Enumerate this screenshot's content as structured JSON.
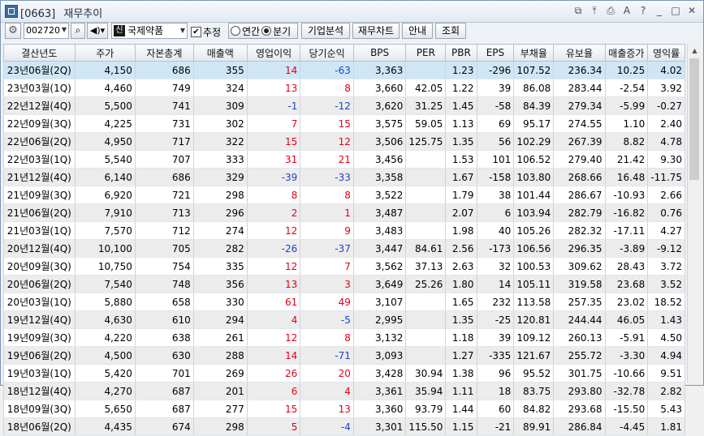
{
  "window": {
    "code": "[0663]",
    "title": "재무추이",
    "buttons": [
      "restore-icon",
      "pin-icon",
      "screenshot-icon",
      "text-size-icon",
      "help-icon",
      "minimize-icon",
      "maximize-icon",
      "close-icon"
    ]
  },
  "toolbar": {
    "stock_code": "002720",
    "stock_badge": "신",
    "stock_name": "국제약품",
    "estimate_label": "추정",
    "estimate_checked": true,
    "radio_annual": "연간",
    "radio_quarter": "분기",
    "selected_period": "분기",
    "btn_analysis": "기업분석",
    "btn_chart": "재무차트",
    "btn_guide": "안내",
    "btn_query": "조회"
  },
  "table": {
    "columns": [
      "결산년도",
      "주가",
      "자본총계",
      "매출액",
      "영업이익",
      "당기순익",
      "BPS",
      "PER",
      "PBR",
      "EPS",
      "부채율",
      "유보율",
      "매출증가",
      "영익률"
    ],
    "rows": [
      [
        "23년06월(2Q)",
        "4,150",
        "686",
        "355",
        "14",
        "-63",
        "3,363",
        "",
        "1.23",
        "-296",
        "107.52",
        "236.34",
        "10.25",
        "4.02"
      ],
      [
        "23년03월(1Q)",
        "4,460",
        "749",
        "324",
        "13",
        "8",
        "3,660",
        "42.05",
        "1.22",
        "39",
        "86.08",
        "283.44",
        "-2.54",
        "3.92"
      ],
      [
        "22년12월(4Q)",
        "5,500",
        "741",
        "309",
        "-1",
        "-12",
        "3,620",
        "31.25",
        "1.45",
        "-58",
        "84.39",
        "279.34",
        "-5.99",
        "-0.27"
      ],
      [
        "22년09월(3Q)",
        "4,225",
        "731",
        "302",
        "7",
        "15",
        "3,575",
        "59.05",
        "1.13",
        "69",
        "95.17",
        "274.55",
        "1.10",
        "2.40"
      ],
      [
        "22년06월(2Q)",
        "4,950",
        "717",
        "322",
        "15",
        "12",
        "3,506",
        "125.75",
        "1.35",
        "56",
        "102.29",
        "267.39",
        "8.82",
        "4.78"
      ],
      [
        "22년03월(1Q)",
        "5,540",
        "707",
        "333",
        "31",
        "21",
        "3,456",
        "",
        "1.53",
        "101",
        "106.52",
        "279.40",
        "21.42",
        "9.30"
      ],
      [
        "21년12월(4Q)",
        "6,140",
        "686",
        "329",
        "-39",
        "-33",
        "3,358",
        "",
        "1.67",
        "-158",
        "103.80",
        "268.66",
        "16.48",
        "-11.75"
      ],
      [
        "21년09월(3Q)",
        "6,920",
        "721",
        "298",
        "8",
        "8",
        "3,522",
        "",
        "1.79",
        "38",
        "101.44",
        "286.67",
        "-10.93",
        "2.66"
      ],
      [
        "21년06월(2Q)",
        "7,910",
        "713",
        "296",
        "2",
        "1",
        "3,487",
        "",
        "2.07",
        "6",
        "103.94",
        "282.79",
        "-16.82",
        "0.76"
      ],
      [
        "21년03월(1Q)",
        "7,570",
        "712",
        "274",
        "12",
        "9",
        "3,483",
        "",
        "1.98",
        "40",
        "105.26",
        "282.32",
        "-17.11",
        "4.27"
      ],
      [
        "20년12월(4Q)",
        "10,100",
        "705",
        "282",
        "-26",
        "-37",
        "3,447",
        "84.61",
        "2.56",
        "-173",
        "106.56",
        "296.35",
        "-3.89",
        "-9.12"
      ],
      [
        "20년09월(3Q)",
        "10,750",
        "754",
        "335",
        "12",
        "7",
        "3,562",
        "37.13",
        "2.63",
        "32",
        "100.53",
        "309.62",
        "28.43",
        "3.72"
      ],
      [
        "20년06월(2Q)",
        "7,540",
        "748",
        "356",
        "13",
        "3",
        "3,649",
        "25.26",
        "1.80",
        "14",
        "105.11",
        "319.58",
        "23.68",
        "3.52"
      ],
      [
        "20년03월(1Q)",
        "5,880",
        "658",
        "330",
        "61",
        "49",
        "3,107",
        "",
        "1.65",
        "232",
        "113.58",
        "257.35",
        "23.02",
        "18.52"
      ],
      [
        "19년12월(4Q)",
        "4,630",
        "610",
        "294",
        "4",
        "-5",
        "2,995",
        "",
        "1.35",
        "-25",
        "120.81",
        "244.44",
        "46.05",
        "1.43"
      ],
      [
        "19년09월(3Q)",
        "4,220",
        "638",
        "261",
        "12",
        "8",
        "3,132",
        "",
        "1.18",
        "39",
        "109.12",
        "260.13",
        "-5.91",
        "4.50"
      ],
      [
        "19년06월(2Q)",
        "4,500",
        "630",
        "288",
        "14",
        "-71",
        "3,093",
        "",
        "1.27",
        "-335",
        "121.67",
        "255.72",
        "-3.30",
        "4.94"
      ],
      [
        "19년03월(1Q)",
        "5,420",
        "701",
        "269",
        "26",
        "20",
        "3,428",
        "30.94",
        "1.38",
        "96",
        "95.52",
        "301.75",
        "-10.66",
        "9.51"
      ],
      [
        "18년12월(4Q)",
        "4,270",
        "687",
        "201",
        "6",
        "4",
        "3,361",
        "35.94",
        "1.11",
        "18",
        "83.75",
        "293.80",
        "-32.78",
        "2.82"
      ],
      [
        "18년09월(3Q)",
        "5,650",
        "687",
        "277",
        "15",
        "13",
        "3,360",
        "93.79",
        "1.44",
        "60",
        "84.82",
        "293.68",
        "-15.50",
        "5.43"
      ],
      [
        "18년06월(2Q)",
        "4,435",
        "674",
        "298",
        "5",
        "-4",
        "3,301",
        "115.50",
        "1.15",
        "-21",
        "89.91",
        "286.84",
        "-4.45",
        "1.81"
      ]
    ]
  },
  "colors": {
    "positive": "#e0001a",
    "negative": "#1c44c9",
    "selected_row": "#cfe6f7",
    "alt_row": "#ececec"
  }
}
